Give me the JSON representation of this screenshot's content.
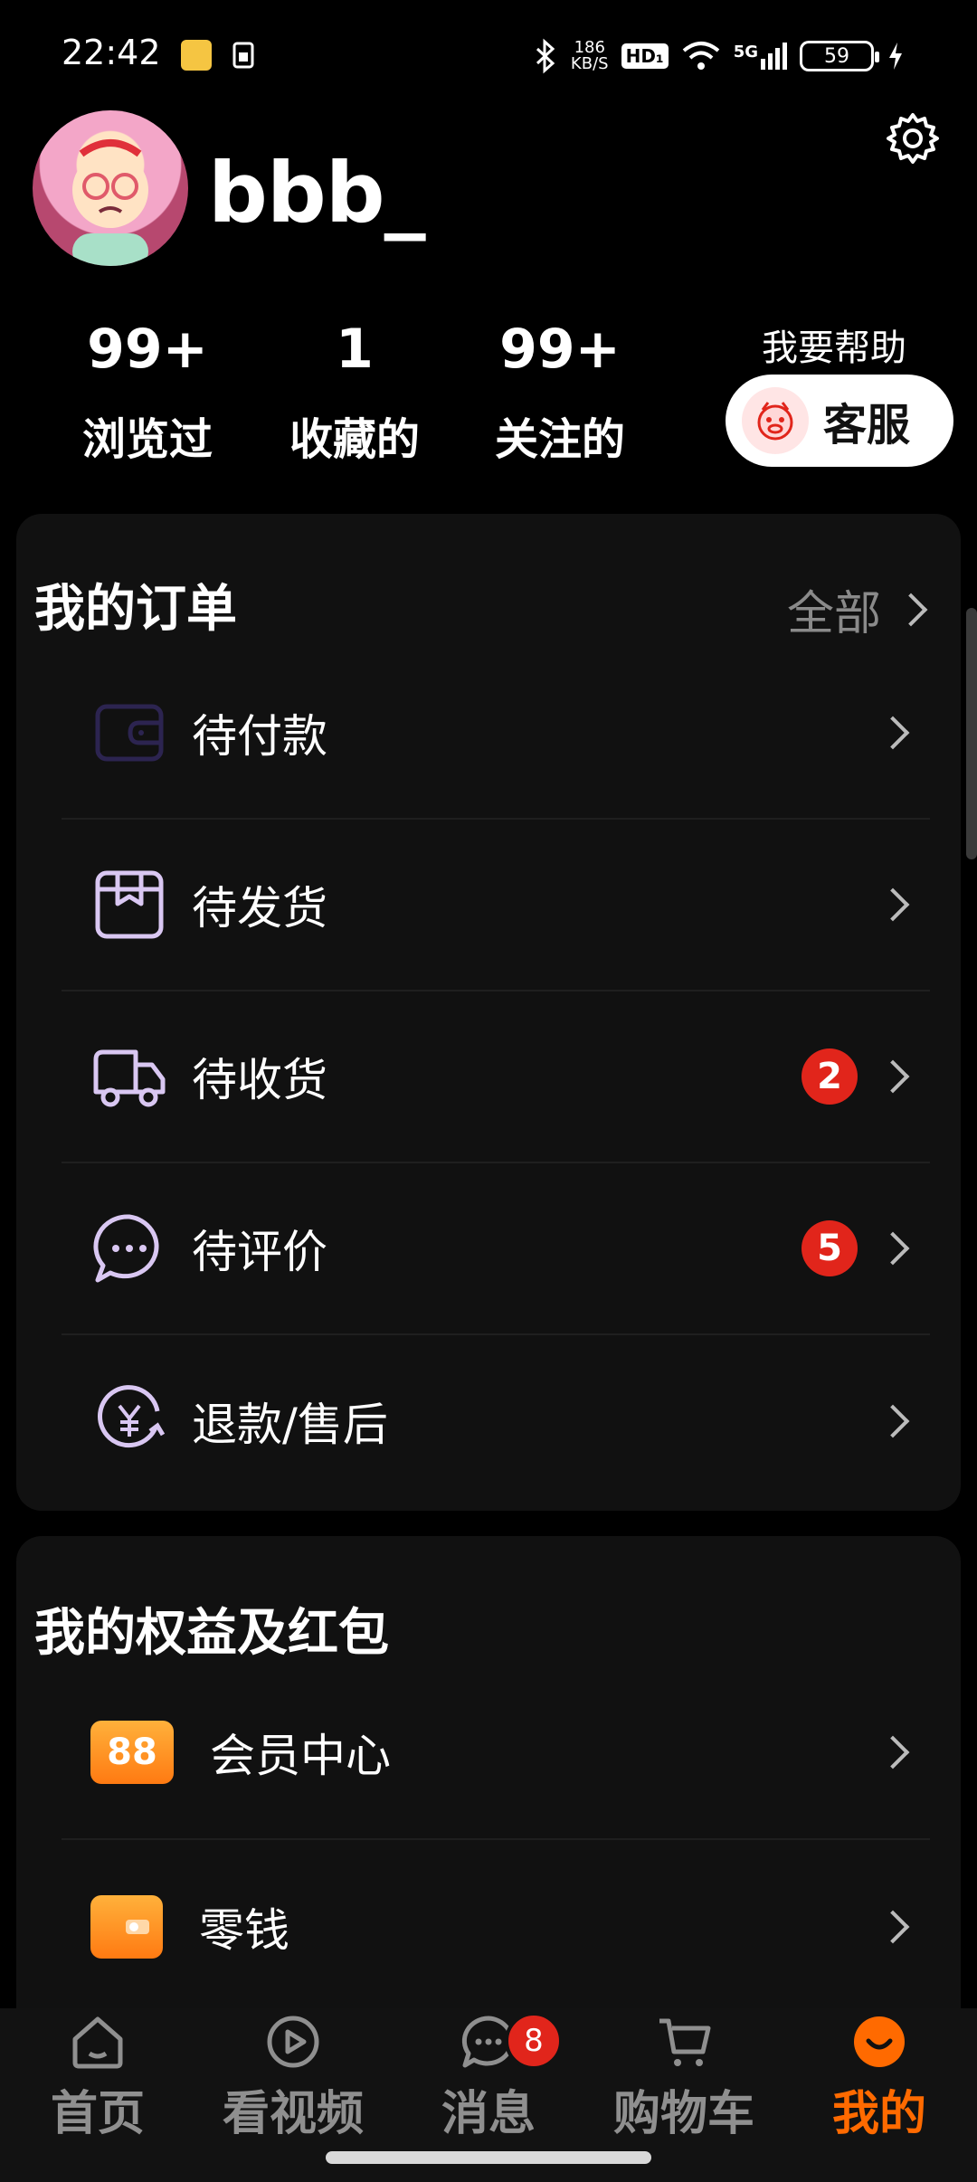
{
  "status_bar": {
    "time": "22:42",
    "speed_value": "186",
    "speed_unit": "KB/S",
    "hd_label": "HD₁",
    "network_label": "5G",
    "battery": "59"
  },
  "profile": {
    "username": "bbb_",
    "stats": [
      {
        "value": "99+",
        "label": "浏览过"
      },
      {
        "value": "1",
        "label": "收藏的"
      },
      {
        "value": "99+",
        "label": "关注的"
      }
    ],
    "help_label": "我要帮助",
    "service_label": "客服"
  },
  "orders": {
    "title": "我的订单",
    "all_label": "全部",
    "items": [
      {
        "label": "待付款",
        "icon": "wallet-icon",
        "badge": ""
      },
      {
        "label": "待发货",
        "icon": "package-icon",
        "badge": ""
      },
      {
        "label": "待收货",
        "icon": "truck-icon",
        "badge": "2"
      },
      {
        "label": "待评价",
        "icon": "chat-bubble-icon",
        "badge": "5"
      },
      {
        "label": "退款/售后",
        "icon": "refund-yen-icon",
        "badge": ""
      }
    ]
  },
  "benefits": {
    "title": "我的权益及红包",
    "items": [
      {
        "label": "会员中心",
        "icon_text": "88",
        "icon": "member-88-icon"
      },
      {
        "label": "零钱",
        "icon_text": "",
        "icon": "wallet-coin-icon"
      }
    ]
  },
  "tabbar": {
    "tabs": [
      {
        "label": "首页",
        "icon": "home-icon"
      },
      {
        "label": "看视频",
        "icon": "play-icon"
      },
      {
        "label": "消息",
        "icon": "message-icon",
        "badge": "8"
      },
      {
        "label": "购物车",
        "icon": "cart-icon"
      },
      {
        "label": "我的",
        "icon": "smile-icon",
        "active": true
      }
    ]
  },
  "colors": {
    "accent": "#ff6a00",
    "badge": "#e1251b",
    "card": "#111111",
    "icon_line": "#d9c7f2"
  }
}
